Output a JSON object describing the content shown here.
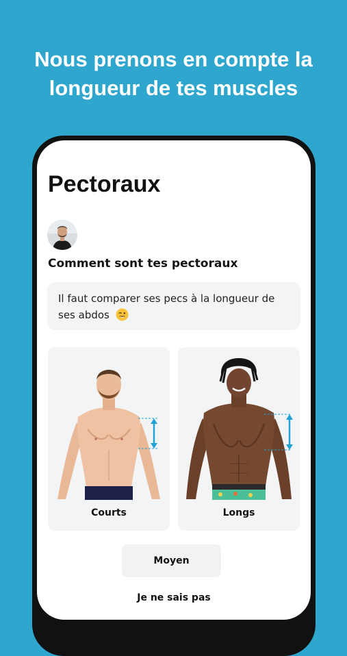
{
  "banner": {
    "line1": "Nous prenons en compte la",
    "line2": "longueur de tes muscles"
  },
  "screen": {
    "title": "Pectoraux",
    "question": "Comment sont tes pectoraux",
    "hint_text": "Il faut comparer ses pecs à la longueur de ses abdos",
    "hint_emoji": "winking-face-emoji"
  },
  "options": [
    {
      "label": "Courts"
    },
    {
      "label": "Longs"
    }
  ],
  "buttons": {
    "medium": "Moyen",
    "unknown": "Je ne sais pas"
  },
  "colors": {
    "background": "#2ea6cd",
    "accent_marker": "#1fa3d4",
    "card_bg": "#f3f4f5"
  }
}
